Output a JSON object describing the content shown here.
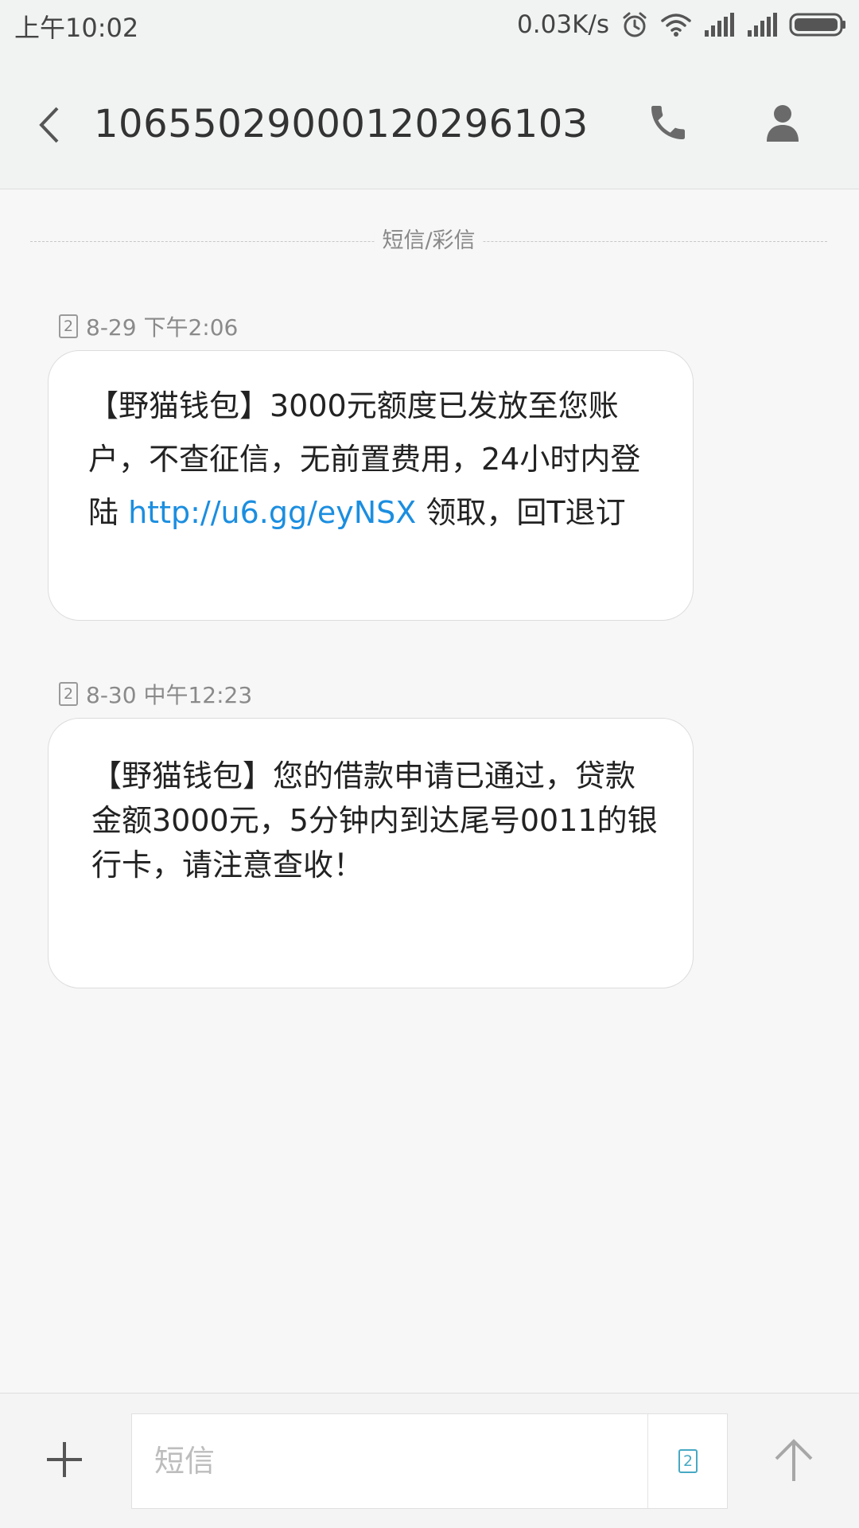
{
  "status_bar": {
    "time": "上午10:02",
    "net_speed": "0.03K/s",
    "icons": [
      "alarm-icon",
      "wifi-icon",
      "signal-icon",
      "signal-icon",
      "battery-icon"
    ]
  },
  "header": {
    "title": "1065502900012029610З",
    "icons": [
      "back-icon",
      "phone-icon",
      "person-icon"
    ]
  },
  "thread": {
    "divider_label": "短信/彩信",
    "messages": [
      {
        "sim": "2",
        "timestamp": "8-29 下午2:06",
        "text_before": "【野猫钱包】3000元额度已发放至您账户，不查征信，无前置费用，24小时内登陆 ",
        "link": "http://u6.gg/eyNSX",
        "text_after": " 领取，回T退订"
      },
      {
        "sim": "2",
        "timestamp": "8-30 中午12:23",
        "text": "【野猫钱包】您的借款申请已通过，贷款金额3000元，5分钟内到达尾号0011的银行卡，请注意查收！"
      }
    ]
  },
  "compose": {
    "placeholder": "短信",
    "sim": "2",
    "icons": [
      "plus-icon",
      "sim-card-icon",
      "send-arrow-icon"
    ]
  },
  "colors": {
    "link": "#1b8ee0",
    "sim_accent": "#46a9c4",
    "header_bg": "#f1f2f2",
    "page_bg": "#f7f7f7"
  }
}
